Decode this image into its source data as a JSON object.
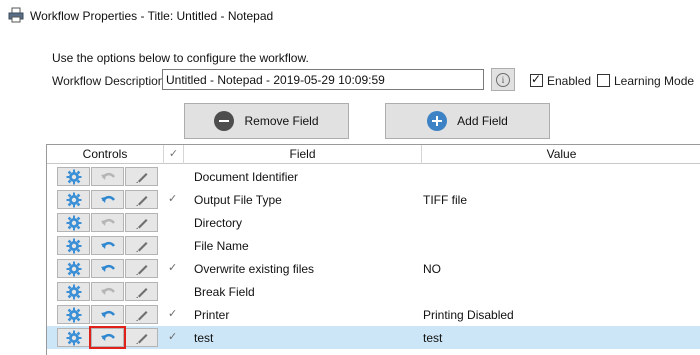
{
  "window": {
    "title": "Workflow Properties - Title: Untitled - Notepad",
    "icon": "printer-icon"
  },
  "intro_text": "Use the options below to configure the workflow.",
  "description": {
    "label": "Workflow Description:",
    "value": "Untitled - Notepad - 2019-05-29 10:09:59"
  },
  "options": {
    "enabled_label": "Enabled",
    "enabled_checked": true,
    "learning_label": "Learning Mode",
    "learning_checked": false
  },
  "buttons": {
    "remove_label": "Remove Field",
    "add_label": "Add Field"
  },
  "grid": {
    "headers": {
      "controls": "Controls",
      "check": "✓",
      "field": "Field",
      "value": "Value"
    },
    "rows": [
      {
        "field": "Document Identifier",
        "value": "",
        "checked": false,
        "undo_enabled": false
      },
      {
        "field": "Output File Type",
        "value": "TIFF file",
        "checked": true,
        "undo_enabled": true
      },
      {
        "field": "Directory",
        "value": "",
        "checked": false,
        "undo_enabled": false
      },
      {
        "field": "File Name",
        "value": "",
        "checked": false,
        "undo_enabled": true
      },
      {
        "field": "Overwrite existing files",
        "value": "NO",
        "checked": true,
        "undo_enabled": true
      },
      {
        "field": "Break Field",
        "value": "",
        "checked": false,
        "undo_enabled": false
      },
      {
        "field": "Printer",
        "value": "Printing Disabled",
        "checked": true,
        "undo_enabled": true
      },
      {
        "field": "test",
        "value": "test",
        "checked": true,
        "undo_enabled": true,
        "selected": true
      }
    ]
  },
  "colors": {
    "accent": "#2f87d0",
    "selection": "#cde6f7",
    "highlight_box": "#e0201b"
  }
}
